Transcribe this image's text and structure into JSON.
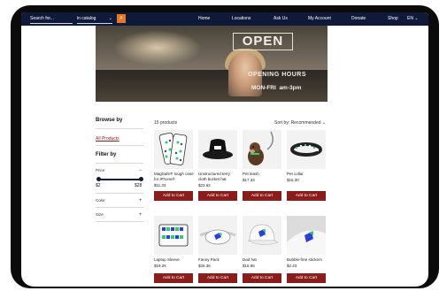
{
  "header": {
    "search_placeholder": "Search for...",
    "scope_value": "in catalog",
    "nav": [
      "Home",
      "Locations",
      "Ask Us",
      "My Account",
      "Donate",
      "Shop"
    ],
    "lang": "EN"
  },
  "hero": {
    "sign": "OPEN",
    "hours_title": "OPENING HOURS",
    "hours_days": "MON-FRI",
    "hours_time": "am-3pm"
  },
  "sidebar": {
    "browse_title": "Browse by",
    "all_products": "All Products",
    "filter_title": "Filter by",
    "price_label": "Price",
    "price_min": "$2",
    "price_max": "$28",
    "price_range": [
      0,
      1
    ],
    "color_label": "Color",
    "size_label": "Size"
  },
  "toolbar": {
    "count": "15 products",
    "sort": "Sort by: Recommended"
  },
  "products": [
    {
      "name": "MagSafe® tough case for iPhone®",
      "price": "$11.33",
      "button": "Add to Cart"
    },
    {
      "name": "Unstructured terry cloth bucket hat",
      "price": "$23.62",
      "button": "Add to Cart"
    },
    {
      "name": "Pet leash",
      "price": "$17.33",
      "button": "Add to Cart"
    },
    {
      "name": "Pet collar",
      "price": "$15.30",
      "button": "Add to Cart"
    },
    {
      "name": "Laptop Sleeve",
      "price": "$19.25",
      "button": "Add to Cart"
    },
    {
      "name": "Fanny Pack",
      "price": "$26.36",
      "button": "Add to Cart"
    },
    {
      "name": "Dad hat",
      "price": "$16.96",
      "button": "Add to Cart"
    },
    {
      "name": "Bubble-free stickers",
      "price": "$2.43",
      "button": "Add to Cart"
    }
  ],
  "colors": {
    "topbar": "#0f1a3a",
    "search_button": "#e4782b",
    "cart_button": "#8b1c1c",
    "logo_blue": "#2b3fd6",
    "logo_green": "#2ecc71"
  }
}
